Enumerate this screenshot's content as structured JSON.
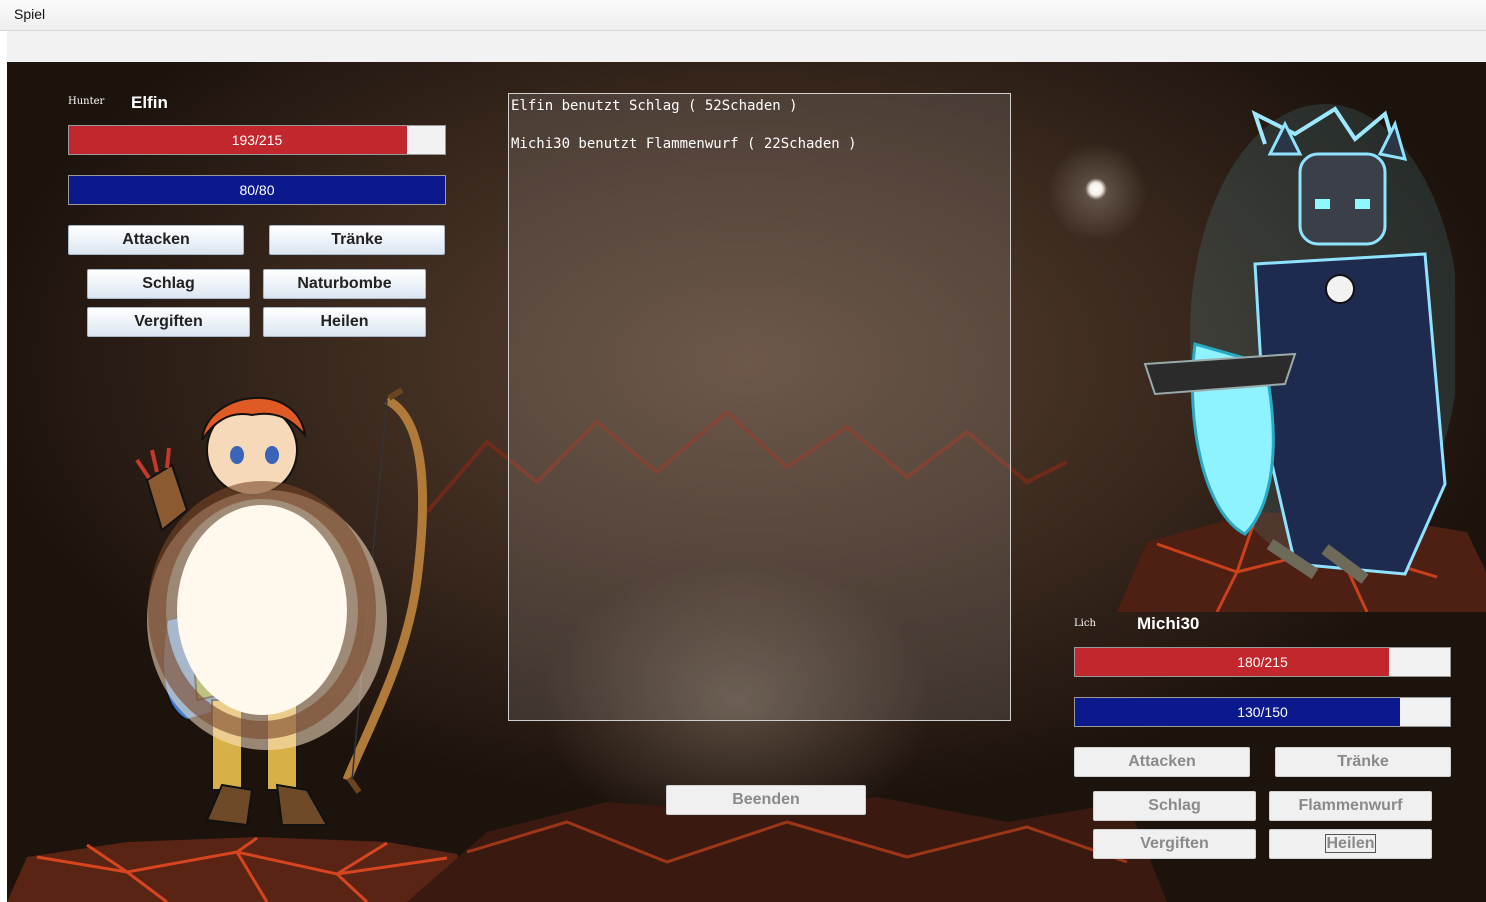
{
  "menubar": {
    "menu": "Spiel"
  },
  "player": {
    "class": "Hunter",
    "name": "Elfin",
    "hp": {
      "current": 193,
      "max": 215,
      "text": "193/215"
    },
    "mana": {
      "current": 80,
      "max": 80,
      "text": "80/80"
    },
    "buttons": {
      "attack": "Attacken",
      "potions": "Tränke",
      "strike": "Schlag",
      "nature_bomb": "Naturbombe",
      "poison": "Vergiften",
      "heal": "Heilen"
    }
  },
  "enemy": {
    "class": "Lich",
    "name": "Michi30",
    "hp": {
      "current": 180,
      "max": 215,
      "text": "180/215"
    },
    "mana": {
      "current": 130,
      "max": 150,
      "text": "130/150"
    },
    "buttons": {
      "attack": "Attacken",
      "potions": "Tränke",
      "strike": "Schlag",
      "flame_throw": "Flammenwurf",
      "poison": "Vergiften",
      "heal": "Heilen"
    }
  },
  "battle_log": {
    "lines": [
      "Elfin benutzt Schlag ( 52Schaden )",
      "Michi30 benutzt Flammenwurf ( 22Schaden )"
    ]
  },
  "end_button": "Beenden",
  "colors": {
    "hp_fill": "#c1272d",
    "mana_fill": "#0c198c",
    "background": "#3c2a1f"
  },
  "icons": {
    "player_sprite": "elf-hunter-with-bow",
    "enemy_sprite": "lich-knight-with-ice-sword",
    "effect": "explosion"
  }
}
